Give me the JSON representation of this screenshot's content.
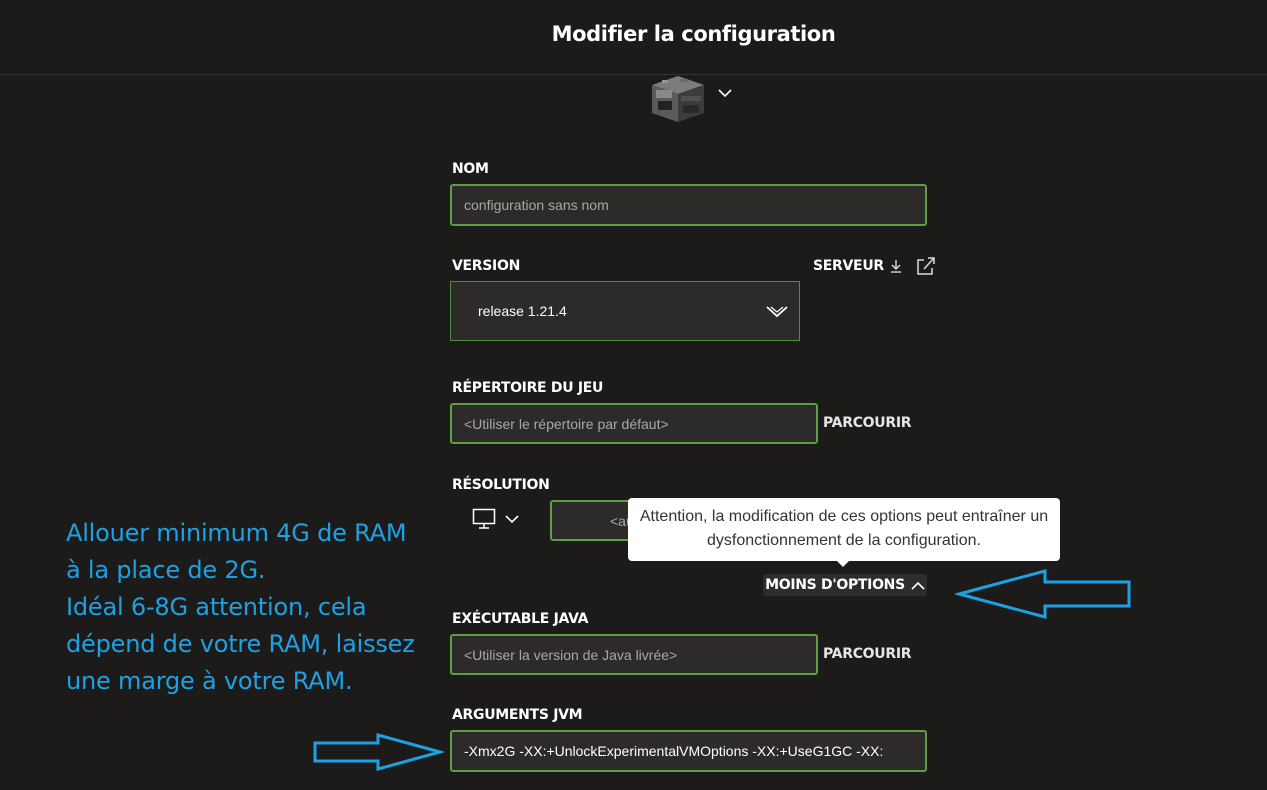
{
  "header": {
    "title": "Modifier la configuration"
  },
  "icon": {
    "name": "furnace-block-icon",
    "dropdown_icon": "chevron-down-icon"
  },
  "form": {
    "name": {
      "label": "NOM",
      "placeholder": "configuration sans nom"
    },
    "version": {
      "label": "VERSION",
      "value": "release 1.21.4",
      "server_link": "SERVEUR"
    },
    "game_dir": {
      "label": "RÉPERTOIRE DU JEU",
      "placeholder": "<Utiliser le répertoire par défaut>",
      "browse": "PARCOURIR"
    },
    "resolution": {
      "label": "RÉSOLUTION",
      "auto_value": "<au"
    },
    "tooltip": "Attention, la modification de ces options peut entraîner un dysfonctionnement de la configuration.",
    "fewer_options": "MOINS D'OPTIONS",
    "java": {
      "label": "EXÉCUTABLE JAVA",
      "placeholder": "<Utiliser la version de Java livrée>",
      "browse": "PARCOURIR"
    },
    "jvm": {
      "label": "ARGUMENTS JVM",
      "value": "-Xmx2G -XX:+UnlockExperimentalVMOptions -XX:+UseG1GC -XX:"
    }
  },
  "annotation": {
    "lines": [
      "Allouer minimum 4G de RAM",
      "à la place de 2G.",
      "Idéal 6-8G attention, cela",
      "dépend de votre RAM, laissez",
      "une marge à votre RAM."
    ],
    "color": "#1da1e3"
  },
  "colors": {
    "background": "#1d1b1a",
    "accent_border": "#5c9f45",
    "field_bg": "#2d2b2a"
  }
}
